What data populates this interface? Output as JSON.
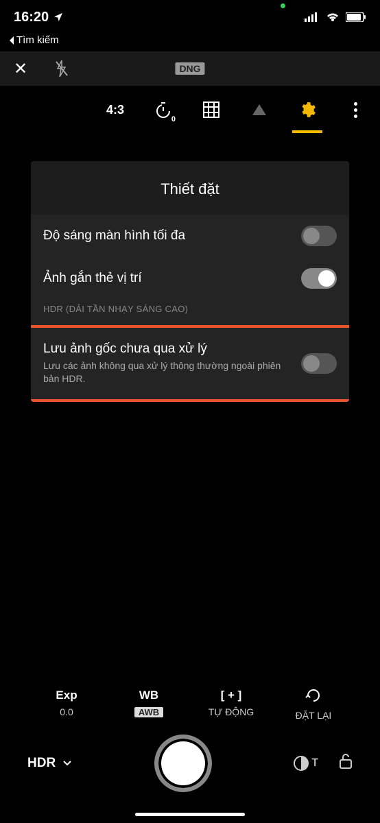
{
  "status": {
    "time": "16:20",
    "back": "Tìm kiếm"
  },
  "topbar": {
    "dng": "DNG"
  },
  "tools": {
    "aspect": "4:3",
    "timer_sub": "0"
  },
  "settings": {
    "title": "Thiết đặt",
    "rows": [
      {
        "label": "Độ sáng màn hình tối đa",
        "on": false
      },
      {
        "label": "Ảnh gắn thẻ vị trí",
        "on": true
      }
    ],
    "section": "HDR (DẢI TẦN NHẠY SÁNG CAO)",
    "highlight": {
      "label": "Lưu ảnh gốc chưa qua xử lý",
      "sub": "Lưu các ảnh không qua xử lý thông thường ngoài phiên bản HDR.",
      "on": false
    }
  },
  "controls": {
    "exp": {
      "top": "Exp",
      "bot": "0.0"
    },
    "wb": {
      "top": "WB",
      "bot": "AWB"
    },
    "focus": {
      "top": "[ + ]",
      "bot": "TỰ ĐỘNG"
    },
    "reset": {
      "top_icon": "↺",
      "bot": "ĐẶT LẠI"
    }
  },
  "shutter": {
    "mode": "HDR",
    "filter": "T"
  }
}
